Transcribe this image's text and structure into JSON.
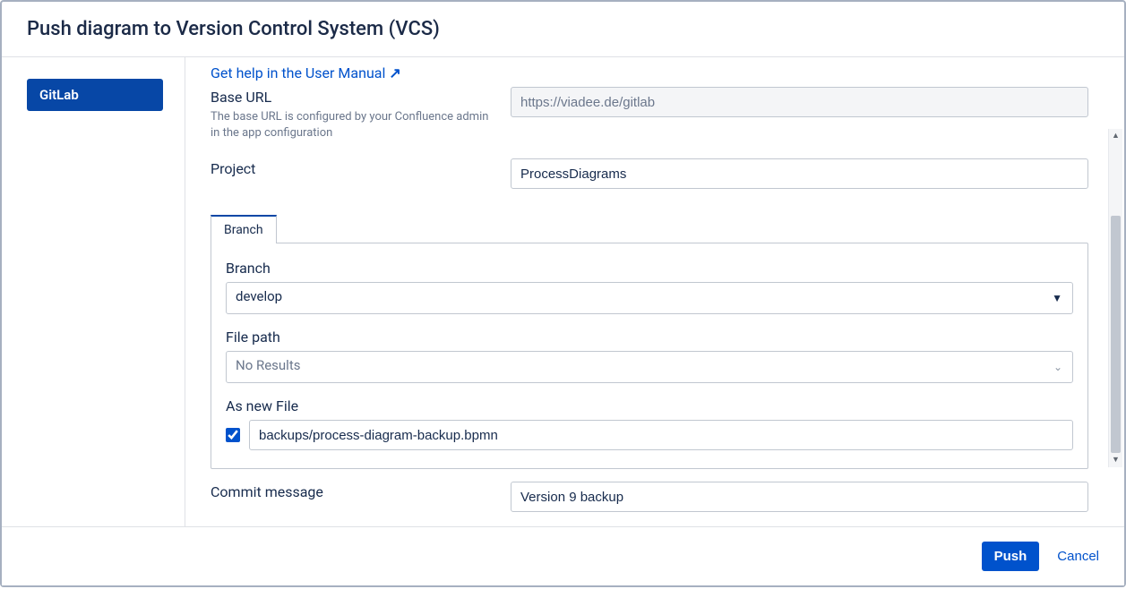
{
  "dialog": {
    "title": "Push diagram to Version Control System (VCS)"
  },
  "sidebar": {
    "items": [
      {
        "label": "GitLab"
      }
    ]
  },
  "helpLink": {
    "text": "Get help in the User Manual",
    "icon": "↗"
  },
  "baseUrl": {
    "label": "Base URL",
    "hint": "The base URL is configured by your Confluence admin in the app configuration",
    "value": "https://viadee.de/gitlab"
  },
  "project": {
    "label": "Project",
    "value": "ProcessDiagrams"
  },
  "tabs": {
    "branch": {
      "label": "Branch"
    }
  },
  "branch": {
    "label": "Branch",
    "value": "develop"
  },
  "filePath": {
    "label": "File path",
    "placeholder": "No Results"
  },
  "newFile": {
    "label": "As new File",
    "checked": true,
    "value": "backups/process-diagram-backup.bpmn"
  },
  "commit": {
    "label": "Commit message",
    "value": "Version 9 backup"
  },
  "footer": {
    "push": "Push",
    "cancel": "Cancel"
  }
}
